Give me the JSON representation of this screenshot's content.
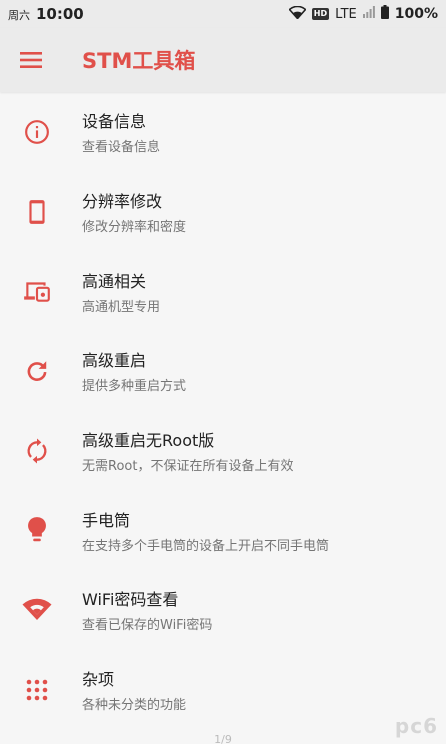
{
  "status_bar": {
    "weekday": "周六",
    "time": "10:00",
    "hd": "HD",
    "network": "LTE",
    "battery": "100%"
  },
  "app_bar": {
    "title": "STM工具箱"
  },
  "colors": {
    "accent": "#e0504a",
    "background": "#f6f6f6",
    "bar": "#ebebeb"
  },
  "items": [
    {
      "title": "设备信息",
      "subtitle": "查看设备信息",
      "icon": "info-icon"
    },
    {
      "title": "分辨率修改",
      "subtitle": "修改分辨率和密度",
      "icon": "phone-icon"
    },
    {
      "title": "高通相关",
      "subtitle": "高通机型专用",
      "icon": "devices-icon"
    },
    {
      "title": "高级重启",
      "subtitle": "提供多种重启方式",
      "icon": "refresh-icon"
    },
    {
      "title": "高级重启无Root版",
      "subtitle": "无需Root，不保证在所有设备上有效",
      "icon": "sync-icon"
    },
    {
      "title": "手电筒",
      "subtitle": "在支持多个手电筒的设备上开启不同手电筒",
      "icon": "lightbulb-icon"
    },
    {
      "title": "WiFi密码查看",
      "subtitle": "查看已保存的WiFi密码",
      "icon": "wifi-icon"
    },
    {
      "title": "杂项",
      "subtitle": "各种未分类的功能",
      "icon": "apps-grid-icon"
    }
  ],
  "pager": "1/9",
  "watermark": "pc6"
}
